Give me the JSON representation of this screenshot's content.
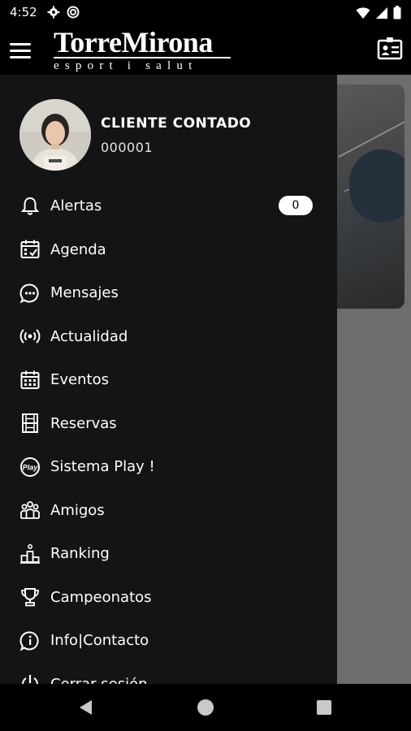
{
  "status_bar": {
    "time": "4:52",
    "left_icons": [
      "settings-icon",
      "sync-icon"
    ],
    "right_icons": [
      "wifi-icon",
      "signal-icon",
      "battery-icon"
    ]
  },
  "app_bar": {
    "logo_main": "TorreMirona",
    "logo_sub": "esport i salut",
    "menu_icon": "hamburger-icon",
    "action_icon": "id-card-icon"
  },
  "profile": {
    "name": "CLIENTE CONTADO",
    "code": "000001"
  },
  "menu": {
    "items": [
      {
        "label": "Alertas",
        "icon": "bell-icon",
        "badge": "0"
      },
      {
        "label": "Agenda",
        "icon": "calendar-check-icon"
      },
      {
        "label": "Mensajes",
        "icon": "chat-bubble-icon"
      },
      {
        "label": "Actualidad",
        "icon": "broadcast-icon"
      },
      {
        "label": "Eventos",
        "icon": "calendar-grid-icon"
      },
      {
        "label": "Reservas",
        "icon": "court-icon"
      },
      {
        "label": "Sistema Play !",
        "icon": "play-badge-icon"
      },
      {
        "label": "Amigos",
        "icon": "group-icon"
      },
      {
        "label": "Ranking",
        "icon": "podium-icon"
      },
      {
        "label": "Campeonatos",
        "icon": "trophy-icon"
      },
      {
        "label": "Info|Contacto",
        "icon": "info-bubble-icon"
      },
      {
        "label": "Cerrar sesión",
        "icon": "power-icon"
      }
    ]
  },
  "nav_bar": {
    "icons": [
      "back-icon",
      "home-icon",
      "recents-icon"
    ]
  },
  "colors": {
    "drawer_bg": "#141414",
    "scrim": "#6d6d6d",
    "text": "#ffffff"
  }
}
